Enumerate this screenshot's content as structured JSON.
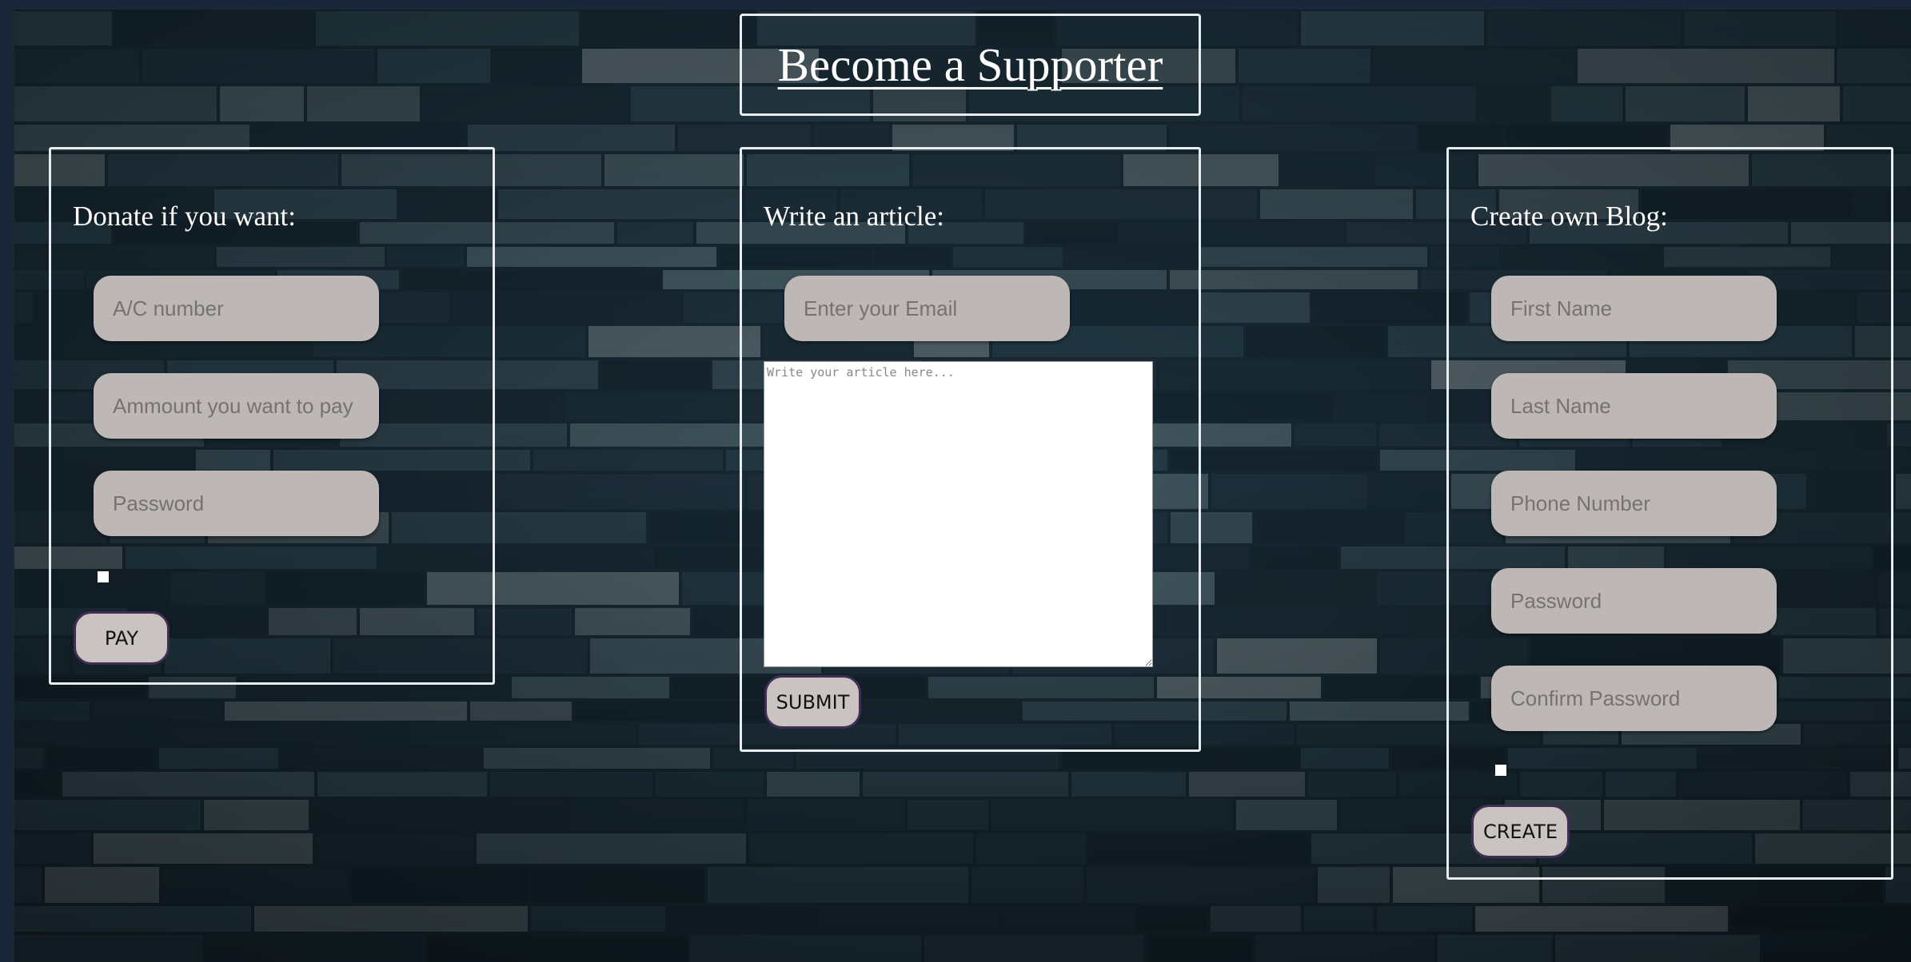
{
  "page": {
    "title": "Become a Supporter",
    "colors": {
      "page_bg": "#1b2638",
      "panel_border": "#e9ecef",
      "field_bg": "#bdb8b5",
      "button_bg": "#c9c3c1",
      "button_border": "#3f2d52"
    }
  },
  "donate": {
    "heading": "Donate if you want:",
    "account_placeholder": "A/C number",
    "amount_placeholder": "Ammount you want to pay",
    "password_placeholder": "Password",
    "checkbox_checked": false,
    "pay_label": "PAY"
  },
  "article": {
    "heading": "Write an article:",
    "email_placeholder": "Enter your Email",
    "body_placeholder": "Write your article here...",
    "submit_label": "SUBMIT"
  },
  "blog": {
    "heading": "Create own Blog:",
    "first_name_placeholder": "First Name",
    "last_name_placeholder": "Last Name",
    "phone_placeholder": "Phone Number",
    "password_placeholder": "Password",
    "confirm_password_placeholder": "Confirm Password",
    "checkbox_checked": false,
    "create_label": "CREATE"
  }
}
